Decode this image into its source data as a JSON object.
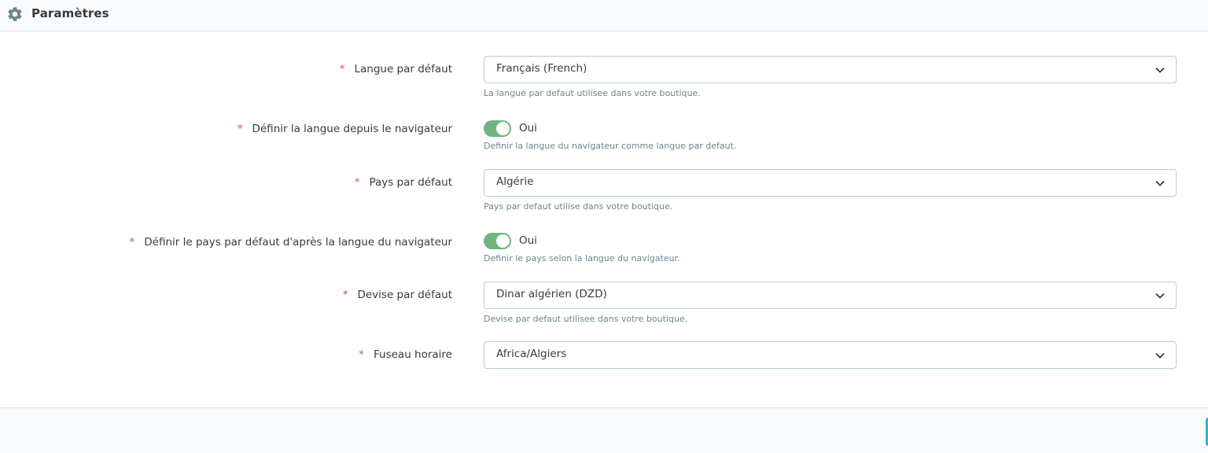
{
  "header": {
    "title": "Paramètres",
    "icon": "gear-icon"
  },
  "fields": {
    "default_language": {
      "label": "Langue par défaut",
      "value": "Français (French)",
      "help": "La langue par defaut utilisee dans votre boutique."
    },
    "browser_language": {
      "label": "Définir la langue depuis le navigateur",
      "toggle_label": "Oui",
      "enabled": true,
      "help": "Definir la langue du navigateur comme langue par defaut."
    },
    "default_country": {
      "label": "Pays par défaut",
      "value": "Algérie",
      "help": "Pays par defaut utilise dans votre boutique."
    },
    "country_from_browser": {
      "label": "Définir le pays par défaut d'après la langue du navigateur",
      "toggle_label": "Oui",
      "enabled": true,
      "help": "Definir le pays selon la langue du navigateur."
    },
    "default_currency": {
      "label": "Devise par défaut",
      "value": "Dinar algérien (DZD)",
      "help": "Devise par defaut utilisee dans votre boutique."
    },
    "timezone": {
      "label": "Fuseau horaire",
      "value": "Africa/Algiers"
    }
  },
  "required_marker": "*",
  "colors": {
    "required": "#e34b4b",
    "toggle_on": "#70b580",
    "primary": "#25b9d7",
    "help_text": "#6c868e",
    "border": "#bbcdd2"
  }
}
